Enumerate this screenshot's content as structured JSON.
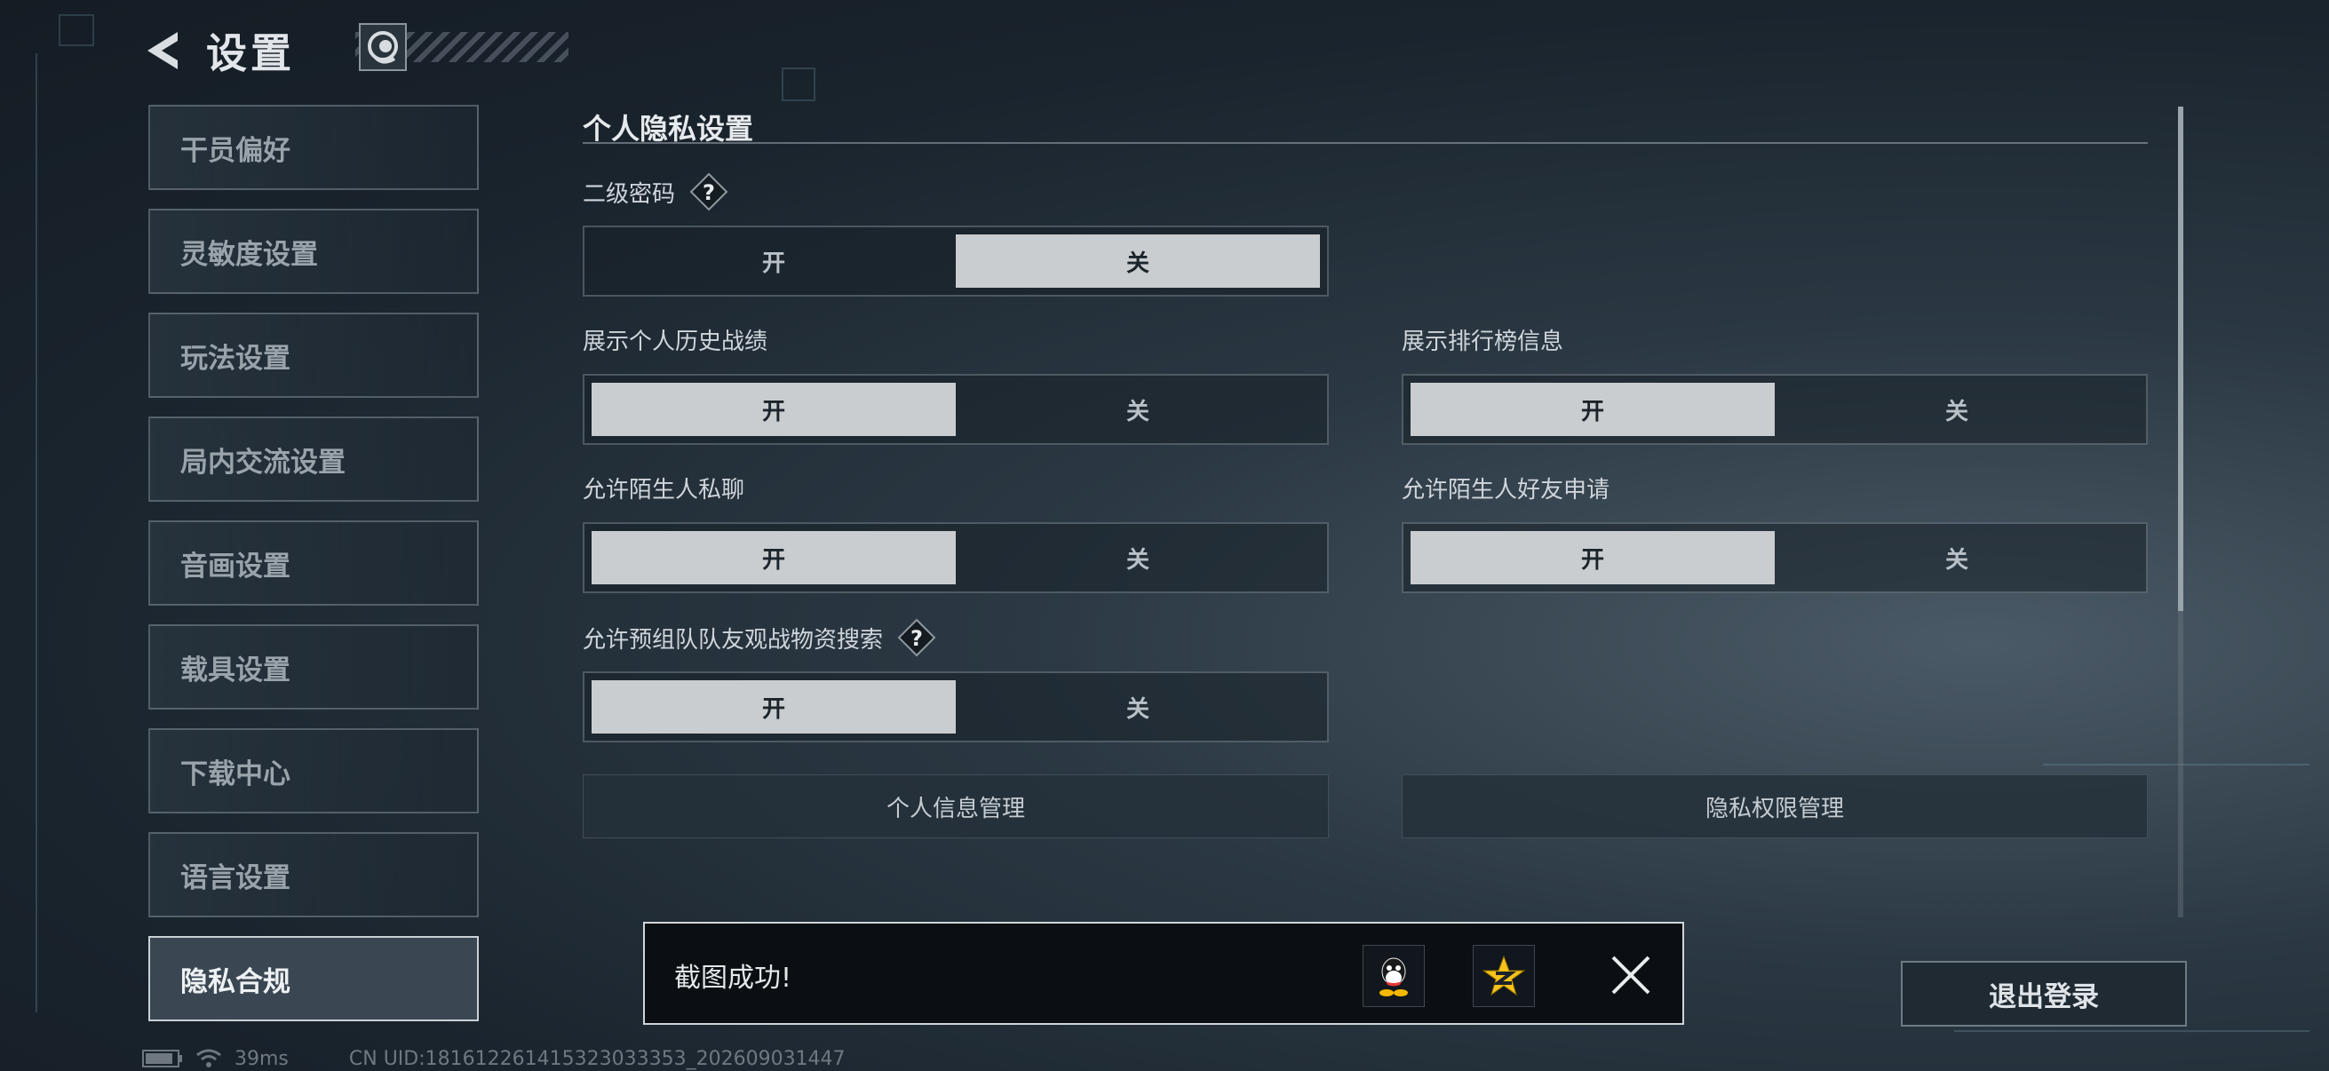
{
  "header": {
    "title": "设置"
  },
  "sidebar": {
    "items": [
      {
        "label": "干员偏好",
        "active": false
      },
      {
        "label": "灵敏度设置",
        "active": false
      },
      {
        "label": "玩法设置",
        "active": false
      },
      {
        "label": "局内交流设置",
        "active": false
      },
      {
        "label": "音画设置",
        "active": false
      },
      {
        "label": "载具设置",
        "active": false
      },
      {
        "label": "下载中心",
        "active": false
      },
      {
        "label": "语言设置",
        "active": false
      },
      {
        "label": "隐私合规",
        "active": true
      }
    ]
  },
  "privacy": {
    "section_title": "个人隐私设置",
    "on_label": "开",
    "off_label": "关",
    "settings": [
      {
        "label": "二级密码",
        "has_help": true,
        "value": "关"
      },
      {
        "label": "展示个人历史战绩",
        "has_help": false,
        "value": "开"
      },
      {
        "label": "展示排行榜信息",
        "has_help": false,
        "value": "开"
      },
      {
        "label": "允许陌生人私聊",
        "has_help": false,
        "value": "开"
      },
      {
        "label": "允许陌生人好友申请",
        "has_help": false,
        "value": "开"
      },
      {
        "label": "允许预组队队友观战物资搜索",
        "has_help": true,
        "value": "开"
      }
    ],
    "personal_info_button": "个人信息管理",
    "privacy_permission_button": "隐私权限管理"
  },
  "toast": {
    "message": "截图成功!",
    "share_icons": [
      "qq-icon",
      "qzone-icon"
    ]
  },
  "logout_button": "退出登录",
  "status": {
    "ping": "39ms",
    "uid": "CN UID:181612261415323033353_202609031447"
  },
  "colors": {
    "toggle_selected_bg": "#c9cdd0",
    "toggle_selected_text": "#1c242b",
    "toast_bg": "#0b0f13"
  }
}
